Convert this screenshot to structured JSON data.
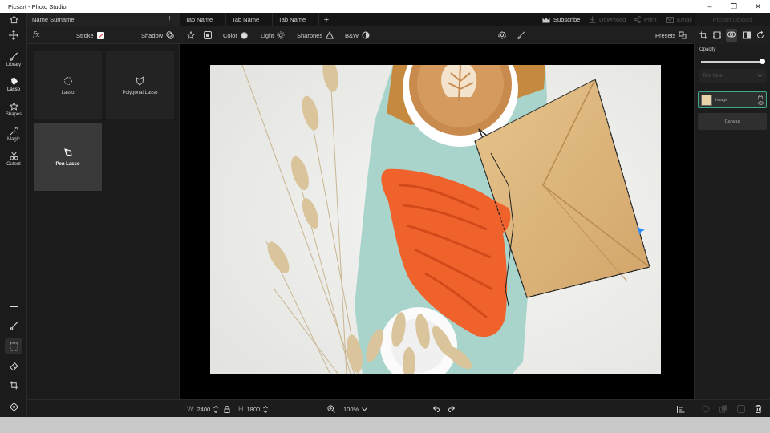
{
  "window": {
    "title": "Picsart - Photo Studio",
    "controls": [
      "–",
      "❐",
      "✕"
    ]
  },
  "user": {
    "name": "Name Surname"
  },
  "tabs": [
    {
      "label": "Tab Name"
    },
    {
      "label": "Tab Name"
    },
    {
      "label": "Tab Name"
    }
  ],
  "header_actions": {
    "subscribe": "Subscribe",
    "download": "Download",
    "print": "Print",
    "email": "Email",
    "upload": "Picsart Upload"
  },
  "effects": {
    "fx": "fx",
    "stroke": "Stroke",
    "shadow": "Shadow"
  },
  "adjust": {
    "color": "Color",
    "light": "Light",
    "sharpness": "Sharpnes",
    "bw": "B&W",
    "presets": "Presets"
  },
  "left_tools": [
    {
      "label": "Library",
      "icon": "brush-icon"
    },
    {
      "label": "Lasso",
      "icon": "lasso-icon"
    },
    {
      "label": "Shapes",
      "icon": "star-icon"
    },
    {
      "label": "Magic",
      "icon": "magic-wand-icon"
    },
    {
      "label": "Cutout",
      "icon": "scissors-icon"
    }
  ],
  "lasso_options": [
    {
      "label": "Lasso",
      "icon": "lasso-dotted-icon",
      "selected": false
    },
    {
      "label": "Polygonal Lasso",
      "icon": "polygonal-lasso-icon",
      "selected": false
    },
    {
      "label": "Pen Lasso",
      "icon": "pen-lasso-icon",
      "selected": true
    }
  ],
  "canvas": {
    "width_label": "W",
    "width": "2400",
    "height_label": "H",
    "height": "1800",
    "zoom": "100%"
  },
  "right_panel": {
    "opacity_label": "Opacity",
    "opacity_value": 0.95,
    "blend_placeholder": "Text here",
    "layers": [
      {
        "name": "Image"
      },
      {
        "name": "Canvas"
      }
    ]
  },
  "colors": {
    "accent": "#4aa3ff",
    "selected_layer_border": "#3fa98a"
  }
}
